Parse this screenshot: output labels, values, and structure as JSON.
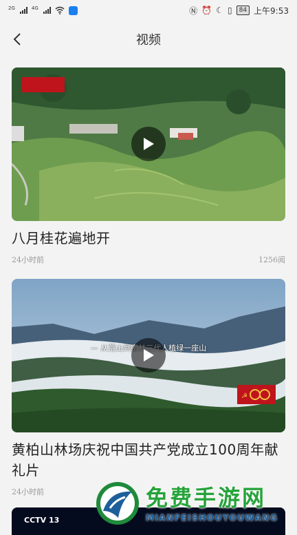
{
  "status_bar": {
    "net_label_1": "2G",
    "net_label_2": "4G",
    "battery": "84",
    "time": "上午9:53"
  },
  "header": {
    "title": "视频"
  },
  "videos": [
    {
      "title": "八月桂花遍地开",
      "time_ago": "24小时前",
      "views": "1256阅",
      "thumbnail_caption": ""
    },
    {
      "title": "黄柏山林场庆祝中国共产党成立100周年献礼片",
      "time_ago": "24小时前",
      "views": "",
      "thumbnail_caption": "— 从荒山到密林三代人植绿一座山"
    },
    {
      "title": "",
      "time_ago": "",
      "views": "",
      "thumbnail_caption": "CCTV 13"
    }
  ],
  "watermark": {
    "text": "免费手游网",
    "subtext": "MIANFEISHOUYOUWANG"
  },
  "colors": {
    "background": "#f3f3f3",
    "watermark_green": "#27a33b",
    "watermark_blue": "#1d5f9a"
  }
}
